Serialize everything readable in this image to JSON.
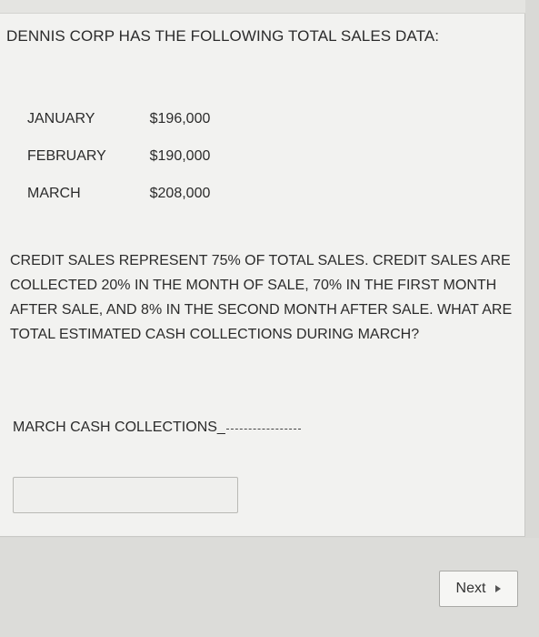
{
  "question": {
    "heading": "DENNIS CORP HAS THE FOLLOWING TOTAL SALES DATA:",
    "sales": [
      {
        "month": "JANUARY",
        "amount": "$196,000"
      },
      {
        "month": "FEBRUARY",
        "amount": "$190,000"
      },
      {
        "month": "MARCH",
        "amount": "$208,000"
      }
    ],
    "body": "CREDIT SALES REPRESENT 75% OF TOTAL SALES. CREDIT SALES ARE COLLECTED 20% IN THE MONTH OF SALE, 70% IN THE FIRST MONTH AFTER SALE, AND 8% IN THE SECOND MONTH AFTER SALE. WHAT ARE TOTAL ESTIMATED CASH COLLECTIONS DURING MARCH?",
    "answer_label": "MARCH CASH COLLECTIONS_",
    "answer_value": ""
  },
  "navigation": {
    "next_label": "Next",
    "next_icon": "right-triangle-icon"
  }
}
